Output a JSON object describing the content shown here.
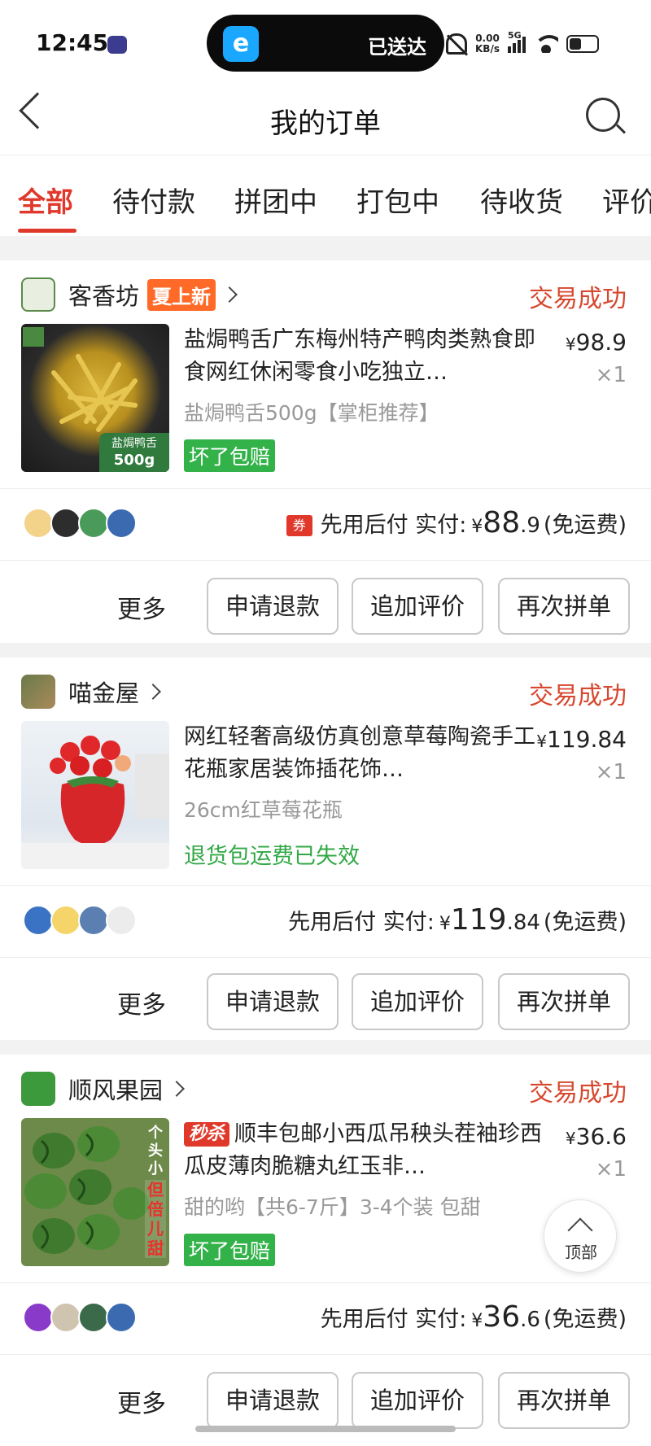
{
  "status_bar": {
    "time": "12:45",
    "island_text": "已送达",
    "net_speed": "0.00",
    "net_unit": "KB/s",
    "network": "5G"
  },
  "nav": {
    "title": "我的订单"
  },
  "tabs": [
    "全部",
    "待付款",
    "拼团中",
    "打包中",
    "待收货",
    "评价"
  ],
  "orders": [
    {
      "shop": "客香坊",
      "shop_tag": "夏上新",
      "status": "交易成功",
      "title": "盐焗鸭舌广东梅州特产鸭肉类熟食即食网红休闲零食小吃独立…",
      "price_cur": "¥",
      "price": "98.9",
      "qty": "×1",
      "sku": "盐焗鸭舌500g【掌柜推荐】",
      "badge": "坏了包赔",
      "thumb_label1": "盐焗鸭舌",
      "thumb_label2": "500g",
      "coupon": "券",
      "pay_label": "先用后付 实付:",
      "pay_cur": "¥",
      "pay_int": "88",
      "pay_dec": ".9",
      "pay_fee": "(免运费)"
    },
    {
      "shop": "喵金屋",
      "status": "交易成功",
      "title": "网红轻奢高级仿真创意草莓陶瓷手工花瓶家居装饰插花饰…",
      "price_cur": "¥",
      "price": "119.84",
      "qty": "×1",
      "sku": "26cm红草莓花瓶",
      "note": "退货包运费已失效",
      "pay_label": "先用后付 实付:",
      "pay_cur": "¥",
      "pay_int": "119",
      "pay_dec": ".84",
      "pay_fee": "(免运费)"
    },
    {
      "shop": "顺风果园",
      "status": "交易成功",
      "title_badge": "秒杀",
      "title": "顺丰包邮小西瓜吊秧头茬袖珍西瓜皮薄肉脆糖丸红玉非…",
      "price_cur": "¥",
      "price": "36.6",
      "qty": "×1",
      "sku": "甜的哟【共6-7斤】3-4个装 包甜",
      "badge": "坏了包赔",
      "thumb_label1": "个头小",
      "thumb_label2": "但倍儿甜",
      "pay_label": "先用后付 实付:",
      "pay_cur": "¥",
      "pay_int": "36",
      "pay_dec": ".6",
      "pay_fee": "(免运费)"
    }
  ],
  "actions": {
    "more": "更多",
    "refund": "申请退款",
    "review": "追加评价",
    "reorder": "再次拼单"
  },
  "back_to_top": "顶部",
  "colors": {
    "accent": "#e0392b",
    "green": "#33b24a",
    "status": "#d6482f"
  }
}
